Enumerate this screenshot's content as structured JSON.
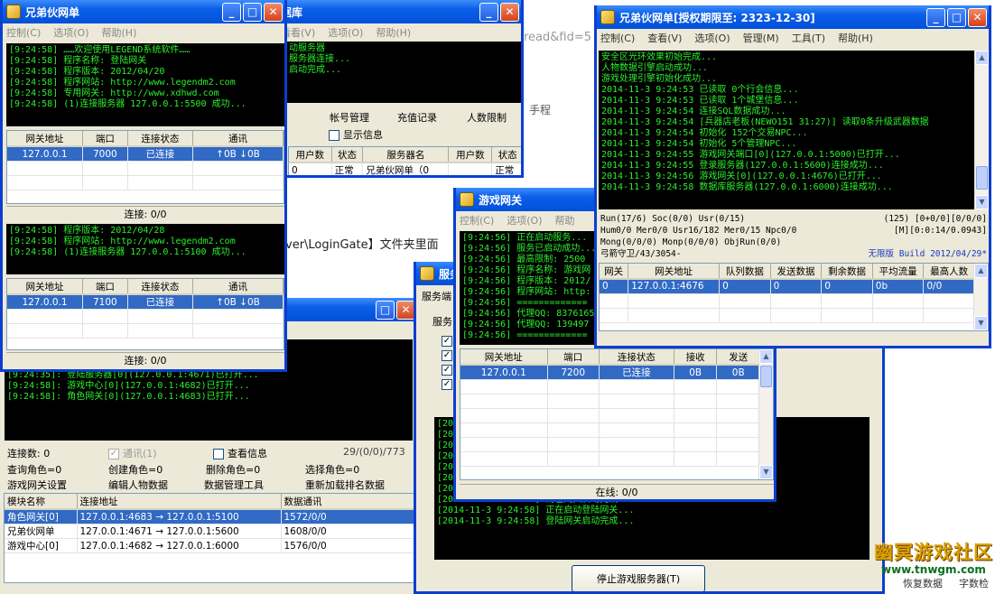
{
  "bg": {
    "url_fragment": "read&fid=5",
    "login_gate_text": "ver\\LoginGate】文件夹里面",
    "bottom_right_1": "恢复数据",
    "bottom_right_2": "字数检",
    "middle_link": "手程"
  },
  "db_window": {
    "title": "据库",
    "menu": [
      "看看(V)",
      "选项(O)",
      "帮助(H)"
    ],
    "log": "动服务器\n服务器连接...\n启动完成...",
    "toolbar": [
      "帐号管理",
      "充值记录",
      "人数限制"
    ],
    "show_info": "显示信息",
    "columns": [
      "用户数",
      "状态",
      "服务器名",
      "用户数",
      "状态"
    ],
    "row": [
      "0",
      "正常",
      "兄弟伙网单（0",
      "",
      "正常"
    ]
  },
  "login_win": {
    "title": "兄弟伙网单",
    "menu": [
      "控制(C)",
      "选项(O)",
      "帮助(H)"
    ],
    "log1": "[9:24:58] ……欢迎使用LEGEND系统软件……\n[9:24:58] 程序名称: 登陆网关\n[9:24:58] 程序版本: 2012/04/20\n[9:24:58] 程序网站: http://www.legendm2.com\n[9:24:58] 专用网关: http://www.xdhwd.com\n[9:24:58] (1)连接服务器 127.0.0.1:5500 成功...",
    "columns": [
      "网关地址",
      "端口",
      "连接状态",
      "通讯"
    ],
    "row1": [
      "127.0.0.1",
      "7000",
      "已连接",
      "↑0B  ↓0B"
    ],
    "status1": "连接: 0/0",
    "log2": "[9:24:58] 程序版本: 2012/04/28\n[9:24:58] 程序网站: http://www.legendm2.com\n[9:24:58] (1)连接服务器 127.0.0.1:5100 成功...",
    "row2": [
      "127.0.0.1",
      "7100",
      "已连接",
      "↑0B  ↓0B"
    ],
    "status2": "连接: 0/0"
  },
  "select_win": {
    "log": "[9:24:35]: 登陆服务器[0](127.0.0.1:4671)已打开...\n[9:24:58]: 游戏中心[0](127.0.0.1:4682)已打开...\n[9:24:58]: 角色网关[0](127.0.0.1:4683)已打开...",
    "conn_count": "连接数: 0",
    "comm": "通讯(1)",
    "view_info": "查看信息",
    "counter": "29/(0/0)/773",
    "row_a": [
      "查询角色=0",
      "创建角色=0",
      "删除角色=0",
      "选择角色=0"
    ],
    "row_b": [
      "游戏网关设置",
      "编辑人物数据",
      "数据管理工具",
      "重新加载排名数据"
    ],
    "columns": [
      "模块名称",
      "连接地址",
      "数据通讯"
    ],
    "rows": [
      [
        "角色网关[0]",
        "127.0.0.1:4683 → 127.0.0.1:5100",
        "1572/0/0"
      ],
      [
        "兄弟伙网单",
        "127.0.0.1:4671 → 127.0.0.1:5600",
        "1608/0/0"
      ],
      [
        "游戏中心[0]",
        "127.0.0.1:4682 → 127.0.0.1:6000",
        "1576/0/0"
      ]
    ]
  },
  "service_win": {
    "title": "服务",
    "label1": "服务端",
    "label2": "服务",
    "log": "[201\n[201\n[201\n[201\n[201\n[201\n[201\n[2014-11-3 9:24:58] 角色网关启动完成...\n[2014-11-3 9:24:58] 正在启动登陆网关...\n[2014-11-3 9:24:58] 登陆网关启动完成...",
    "stop_button": "停止游戏服务器(T)"
  },
  "game_gate": {
    "title": "游戏网关",
    "menu": [
      "控制(C)",
      "选项(O)",
      "帮助"
    ],
    "log": "[9:24:56] 正在启动服务...\n[9:24:56] 服务已启动成功...\n[9:24:56] 最高限制: 2500\n[9:24:56] 程序名称: 游戏网\n[9:24:56] 程序版本: 2012/\n[9:24:56] 程序网站: http:\n[9:24:56] =============\n[9:24:56] 代理QQ: 8376165\n[9:24:56] 代理QQ: 139497\n[9:24:56] =============",
    "columns": [
      "网关地址",
      "端口",
      "连接状态",
      "接收",
      "发送"
    ],
    "row": [
      "127.0.0.1",
      "7200",
      "已连接",
      "0B",
      "0B"
    ],
    "status": "在线: 0/0"
  },
  "m2_win": {
    "title": "兄弟伙网单[授权期限至: 2323-12-30]",
    "menu": [
      "控制(C)",
      "查看(V)",
      "选项(O)",
      "管理(M)",
      "工具(T)",
      "帮助(H)"
    ],
    "log": "安全区光环效果初始完成...\n人物数据引擎启动成功...\n游戏处理引擎初始化成功...\n2014-11-3 9:24:53 已读取 0个行会信息...\n2014-11-3 9:24:53 已读取 1个城堡信息...\n2014-11-3 9:24:54 连接SQL数据成功...\n2014-11-3 9:24:54 [兵器店老板(NEWO151 31:27)] 读取0条升级武器数据\n2014-11-3 9:24:54 初始化 152个交易NPC...\n2014-11-3 9:24:54 初始化 5个管理NPC...\n2014-11-3 9:24:55 游戏网关端口[0](127.0.0.1:5000)已打开...\n2014-11-3 9:24:55 登录服务器(127.0.0.1:5600)连接成功...\n2014-11-3 9:24:56 游戏网关[0](127.0.0.1:4676)已打开...\n2014-11-3 9:24:58 数据库服务器(127.0.0.1:6000)连接成功...",
    "stats1_left": "Run(17/6) Soc(0/0) Usr(0/15)",
    "stats1_right": "(125) [0+0/0][0/0/0]",
    "stats2_left": "Hum0/0 Mer0/0 Usr16/182 Mer0/15 Npc0/0",
    "stats2_right": "[M][0:0:14/0.0943]",
    "stats3_left": "Mong(0/0/0) Monp(0/0/0) ObjRun(0/0)",
    "stats4_left": "弓箭守卫/43/3054-",
    "edition": "无限版",
    "build": "Build 2012/04/29*",
    "columns": [
      "网关",
      "网关地址",
      "队列数据",
      "发送数据",
      "剩余数据",
      "平均流量",
      "最高人数"
    ],
    "row": [
      "0",
      "127.0.0.1:4676",
      "0",
      "0",
      "0",
      "0b",
      "0/0"
    ]
  },
  "watermark": {
    "name": "幽冥游戏社区",
    "site": "www.tnwgm.com"
  }
}
